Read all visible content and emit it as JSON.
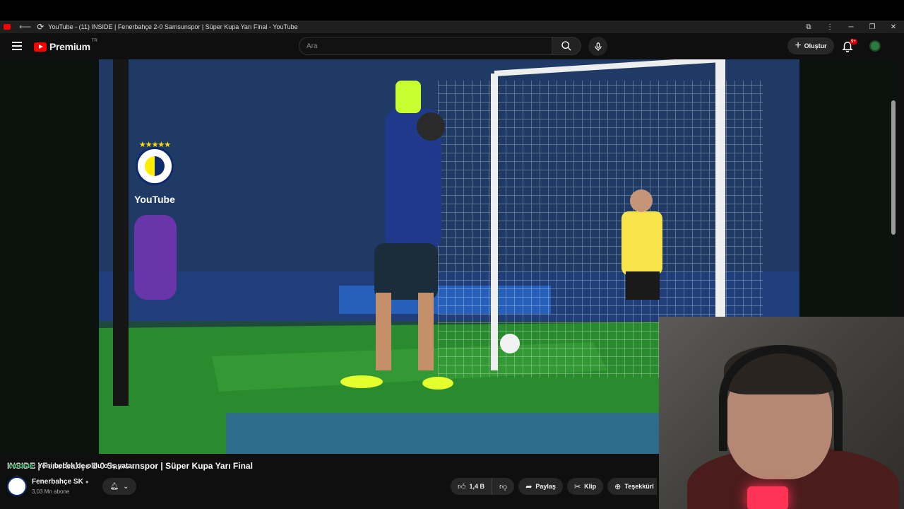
{
  "browser": {
    "window_title": "YouTube - (11) INSIDE | Fenerbahçe 2-0 Samsunspor | Süper Kupa Yarı Final - YouTube"
  },
  "header": {
    "logo_text": "Premium",
    "logo_region": "TR",
    "search_placeholder": "Ara",
    "create_label": "Oluştur",
    "notification_badge": "9+"
  },
  "video": {
    "title": "INSIDE | Fenerbahçe 2-0 Samsunspor | Süper Kupa Yarı Final",
    "watermark_text": "YouTube"
  },
  "overlay_chat": {
    "user": "cmorae",
    "message": ": Yeni bebek de oldu o iş yatar"
  },
  "channel": {
    "name": "Fenerbahçe SK",
    "subscribers": "3,03 Mn abone"
  },
  "actions": {
    "likes": "1,4 B",
    "share": "Paylaş",
    "clip": "Klip",
    "thanks": "Teşekkürl"
  },
  "colors": {
    "brand_red": "#ff0000",
    "fb_yellow": "#ffed00",
    "fb_navy": "#0d2a6b",
    "chat_user": "#4ecf7a"
  }
}
